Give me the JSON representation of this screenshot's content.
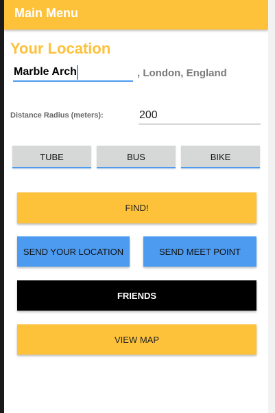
{
  "appbar": {
    "title": "Main Menu"
  },
  "location": {
    "heading": "Your Location",
    "value": "Marble Arch",
    "suffix": ", London, England"
  },
  "radius": {
    "label": "Distance Radius (meters):",
    "value": "200"
  },
  "transport_modes": [
    {
      "label": "TUBE"
    },
    {
      "label": "BUS"
    },
    {
      "label": "BIKE"
    }
  ],
  "actions": {
    "find_label": "FIND!",
    "send_location_label": "SEND YOUR LOCATION",
    "send_meet_point_label": "SEND MEET POINT",
    "friends_label": "FRIENDS",
    "view_map_label": "VIEW MAP"
  },
  "colors": {
    "accent_yellow": "#fdc13a",
    "accent_blue": "#4d9bf0",
    "button_gray": "#d6d7d7",
    "friends_black": "#000000"
  }
}
